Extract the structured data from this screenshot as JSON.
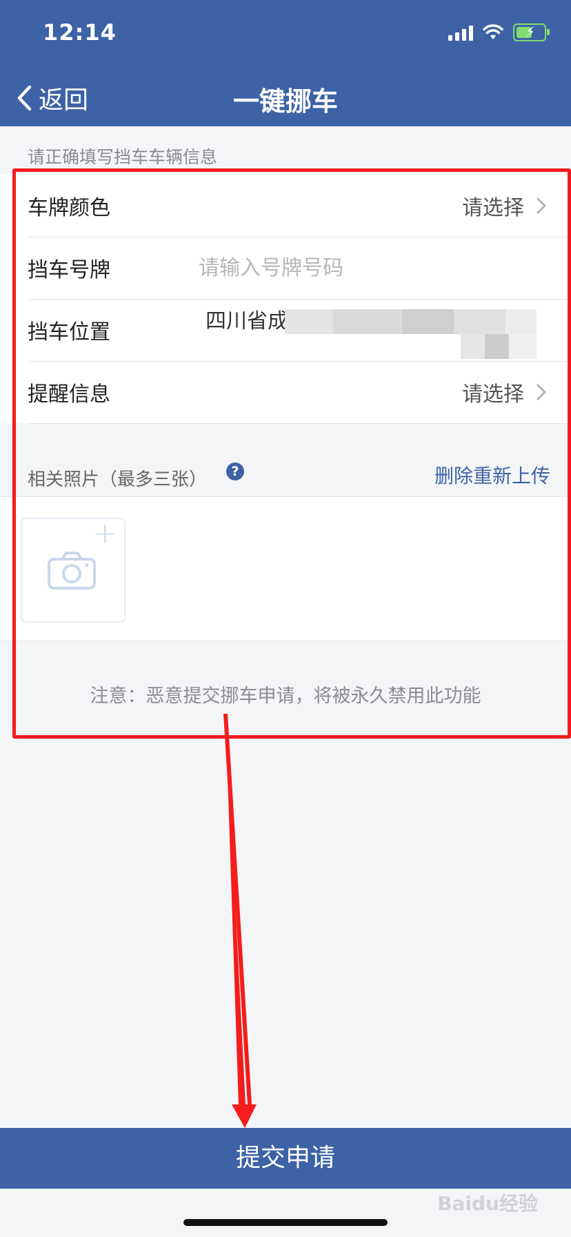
{
  "status_bar": {
    "time": "12:14"
  },
  "nav": {
    "back_label": "返回",
    "title": "一键挪车"
  },
  "form": {
    "hint": "请正确填写挡车车辆信息",
    "plate_color": {
      "label": "车牌颜色",
      "value": "请选择"
    },
    "plate_number": {
      "label": "挡车号牌",
      "placeholder": "请输入号牌号码"
    },
    "location": {
      "label": "挡车位置",
      "value": "四川省成都"
    },
    "reminder": {
      "label": "提醒信息",
      "value": "请选择"
    }
  },
  "photos": {
    "title": "相关照片（最多三张）",
    "help": "?",
    "delete_label": "删除重新上传",
    "plus": "+"
  },
  "notice": "注意：恶意提交挪车申请，将被永久禁用此功能",
  "submit_label": "提交申请",
  "watermark": "Baidu经验",
  "colors": {
    "header": "#3d62a6",
    "annotation": "#f41c1c"
  }
}
